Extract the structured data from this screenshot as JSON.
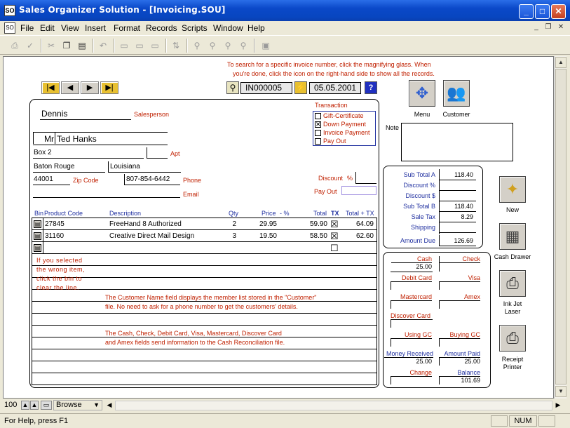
{
  "window": {
    "title": "Sales Organizer Solution - [Invoicing.SOU]",
    "app_icon": "SO",
    "doc_icon": "SO"
  },
  "menu": [
    "File",
    "Edit",
    "View",
    "Insert",
    "Format",
    "Records",
    "Scripts",
    "Window",
    "Help"
  ],
  "hint_search": "To search for a specific invoice number, click the magnifying glass. When",
  "hint_search2": "you're done, click the icon on the right-hand side to show all the records.",
  "invoice": {
    "number": "IN000005",
    "date": "05.05.2001",
    "help": "?"
  },
  "buttons": {
    "menu": "Menu",
    "customer": "Customer",
    "new": "New",
    "cash_drawer": "Cash Drawer",
    "inkjet": "Ink Jet",
    "laser": "Laser",
    "receipt": "Receipt",
    "printer": "Printer"
  },
  "customer": {
    "salesperson": "Dennis",
    "salesperson_label": "Salesperson",
    "title": "Mr",
    "name": "Ted Hanks",
    "address": "Box 2",
    "apt_label": "Apt",
    "city": "Baton Rouge",
    "state": "Louisiana",
    "zip": "44001",
    "zip_label": "Zip Code",
    "phone": "807-854-6442",
    "phone_label": "Phone",
    "email_label": "Email"
  },
  "transaction": {
    "label": "Transaction",
    "options": [
      {
        "label": "Gift-Certificate",
        "checked": false
      },
      {
        "label": "Down Payment",
        "checked": true
      },
      {
        "label": "Invoice Payment",
        "checked": false
      },
      {
        "label": "Pay Out",
        "checked": false
      }
    ]
  },
  "note_label": "Note",
  "discount_label": "Discount",
  "discount_pct": "%",
  "payout_label": "Pay Out",
  "table": {
    "headers": [
      "Bin",
      "Product Code",
      "Description",
      "Qty",
      "Price",
      "- %",
      "Total",
      "TX",
      "Total + TX"
    ],
    "rows": [
      {
        "code": "27845",
        "description": "FreeHand 8 Authorized",
        "qty": "2",
        "price": "29.95",
        "total": "59.90",
        "tx": "☒",
        "total_tx": "64.09"
      },
      {
        "code": "31160",
        "description": "Creative Direct Mail Design",
        "qty": "3",
        "price": "19.50",
        "total": "58.50",
        "tx": "☒",
        "total_tx": "62.60"
      },
      {
        "code": "",
        "description": "",
        "qty": "",
        "price": "",
        "total": "",
        "tx": "☐",
        "total_tx": ""
      }
    ],
    "note_bin": [
      "If you selected",
      "the wrong item,",
      "click the bin to",
      "clear the line."
    ],
    "note_customer": [
      "The Customer Name field displays the member list stored in the \"Customer\"",
      "file. No need to ask for a phone number to get the customers' details."
    ],
    "note_cash": [
      "The Cash, Check, Debit Card, Visa, Mastercard, Discover Card",
      "and Amex fields send information to the Cash Reconciliation file."
    ]
  },
  "totals": [
    {
      "label": "Sub Total A",
      "value": "118.40"
    },
    {
      "label": "Discount %",
      "value": ""
    },
    {
      "label": "Discount $",
      "value": ""
    },
    {
      "label": "Sub Total B",
      "value": "118.40"
    },
    {
      "label": "Sale Tax",
      "value": "8.29"
    },
    {
      "label": "Shipping",
      "value": ""
    },
    {
      "label": "Amount Due",
      "value": "126.69"
    }
  ],
  "payments": {
    "cash": "Cash",
    "cash_value": "25.00",
    "check": "Check",
    "debit": "Debit Card",
    "visa": "Visa",
    "mastercard": "Mastercard",
    "amex": "Amex",
    "discover": "Discover Card",
    "using_gc": "Using GC",
    "buying_gc": "Buying GC",
    "money_received": "Money Received",
    "money_received_value": "25.00",
    "amount_paid": "Amount Paid",
    "amount_paid_value": "25.00",
    "change": "Change",
    "balance": "Balance",
    "balance_value": "101.69"
  },
  "bottom": {
    "zoom": "100",
    "mode": "Browse"
  },
  "status": {
    "help": "For Help, press F1",
    "num": "NUM"
  }
}
